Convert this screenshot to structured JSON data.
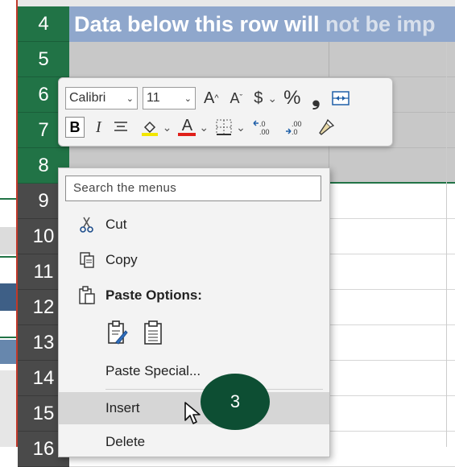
{
  "rows": [
    "4",
    "5",
    "6",
    "7",
    "8",
    "9",
    "10",
    "11",
    "12",
    "13",
    "14",
    "15",
    "16"
  ],
  "banner": {
    "text_main": "Data below this row will ",
    "text_dim": "not be imp"
  },
  "mini_toolbar": {
    "font_name": "Calibri",
    "font_size": "11",
    "bold": "B",
    "italic": "I",
    "increase_font": "A",
    "decrease_font": "A",
    "currency": "$",
    "percent": "%",
    "comma": "❟",
    "font_color_letter": "A"
  },
  "context_menu": {
    "search_placeholder": "Search the menus",
    "items": [
      {
        "label": "Cut",
        "icon": "scissors-icon"
      },
      {
        "label": "Copy",
        "icon": "copy-icon"
      },
      {
        "label": "Paste Options:",
        "icon": "paste-icon"
      },
      {
        "label": "Paste Special...",
        "icon": ""
      },
      {
        "label": "Insert",
        "icon": ""
      },
      {
        "label": "Delete",
        "icon": ""
      }
    ]
  },
  "step_badge": "3",
  "colors": {
    "row_header_green": "#217346",
    "badge_green": "#0d4e33",
    "banner": "#8fa7cc"
  }
}
